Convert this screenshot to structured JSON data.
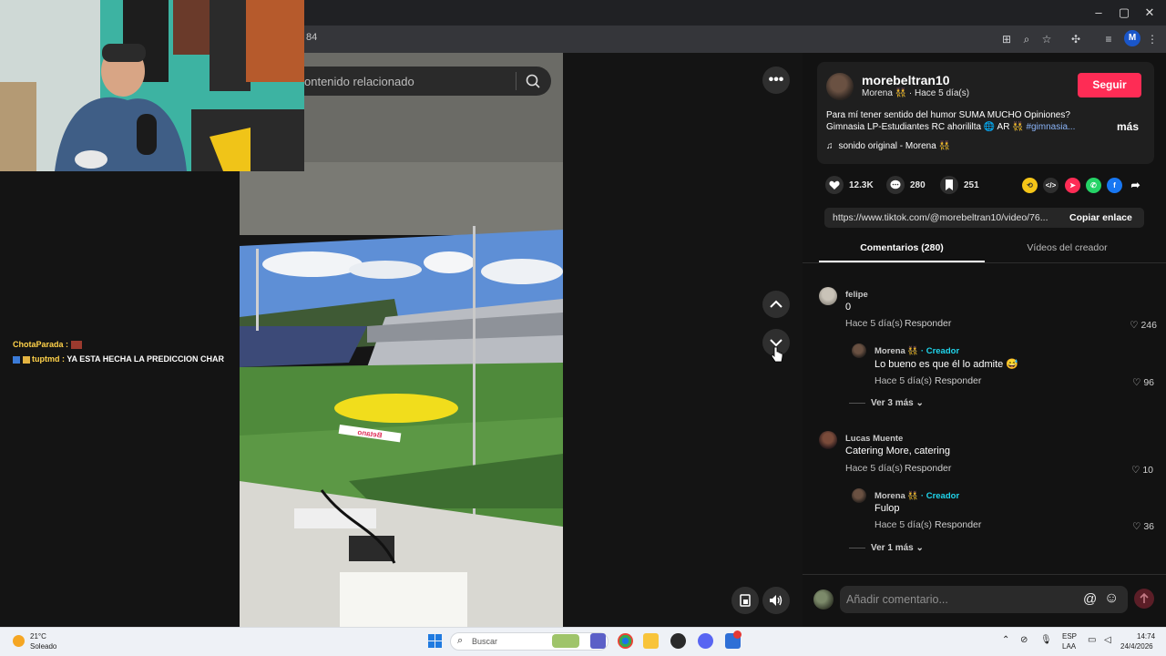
{
  "browser": {
    "url_fragment": "84",
    "profile_initial": "M"
  },
  "search": {
    "placeholder": "ontenido relacionado"
  },
  "chat": [
    {
      "user": "ChotaParada :",
      "message": ""
    },
    {
      "user": "tuptmd :",
      "message": "YA ESTA HECHA LA PREDICCION CHAR"
    }
  ],
  "video": {
    "stadium_text": "Betano"
  },
  "post": {
    "username": "morebeltran10",
    "display_line": "Morena 👯 · Hace 5 día(s)",
    "follow_label": "Seguir",
    "description_line1": "Para mí tener sentido del humor SUMA MUCHO Opiniones?",
    "description_line2": "Gimnasia LP-Estudiantes RC ahorililta 🌐 AR 👯 ",
    "hashtag": "#gimnasia...",
    "more_label": "más",
    "music": "sonido original - Morena 👯"
  },
  "stats": {
    "likes": "12.3K",
    "comments": "280",
    "saves": "251"
  },
  "link": {
    "url": "https://www.tiktok.com/@morebeltran10/video/76...",
    "copy_label": "Copiar enlace"
  },
  "tabs": {
    "comments": "Comentarios (280)",
    "creator_videos": "Vídeos del creador"
  },
  "comments": [
    {
      "name": "felipe",
      "text": "0",
      "time": "Hace 5 día(s)",
      "reply_label": "Responder",
      "likes": "246",
      "reply": {
        "name": "Morena 👯",
        "creator_tag": " · Creador",
        "text": "Lo bueno es que él lo admite 😅",
        "time": "Hace 5 día(s)",
        "reply_label": "Responder",
        "likes": "96"
      },
      "view_more": "Ver 3 más"
    },
    {
      "name": "Lucas Muente",
      "text": "Catering More, catering",
      "time": "Hace 5 día(s)",
      "reply_label": "Responder",
      "likes": "10",
      "reply": {
        "name": "Morena 👯",
        "creator_tag": " · Creador",
        "text": "Fulop",
        "time": "Hace 5 día(s)",
        "reply_label": "Responder",
        "likes": "36"
      },
      "view_more": "Ver 1 más"
    }
  ],
  "comment_input": {
    "placeholder": "Añadir comentario..."
  },
  "taskbar": {
    "weather_temp": "21°C",
    "weather_desc": "Soleado",
    "search_placeholder": "Buscar",
    "lang1": "ESP",
    "lang2": "LAA",
    "time": "14:74",
    "date": "24/4/2026"
  },
  "colors": {
    "follow": "#fe2c55",
    "creator": "#20d5ec",
    "hashtag": "#8ab4f8"
  }
}
